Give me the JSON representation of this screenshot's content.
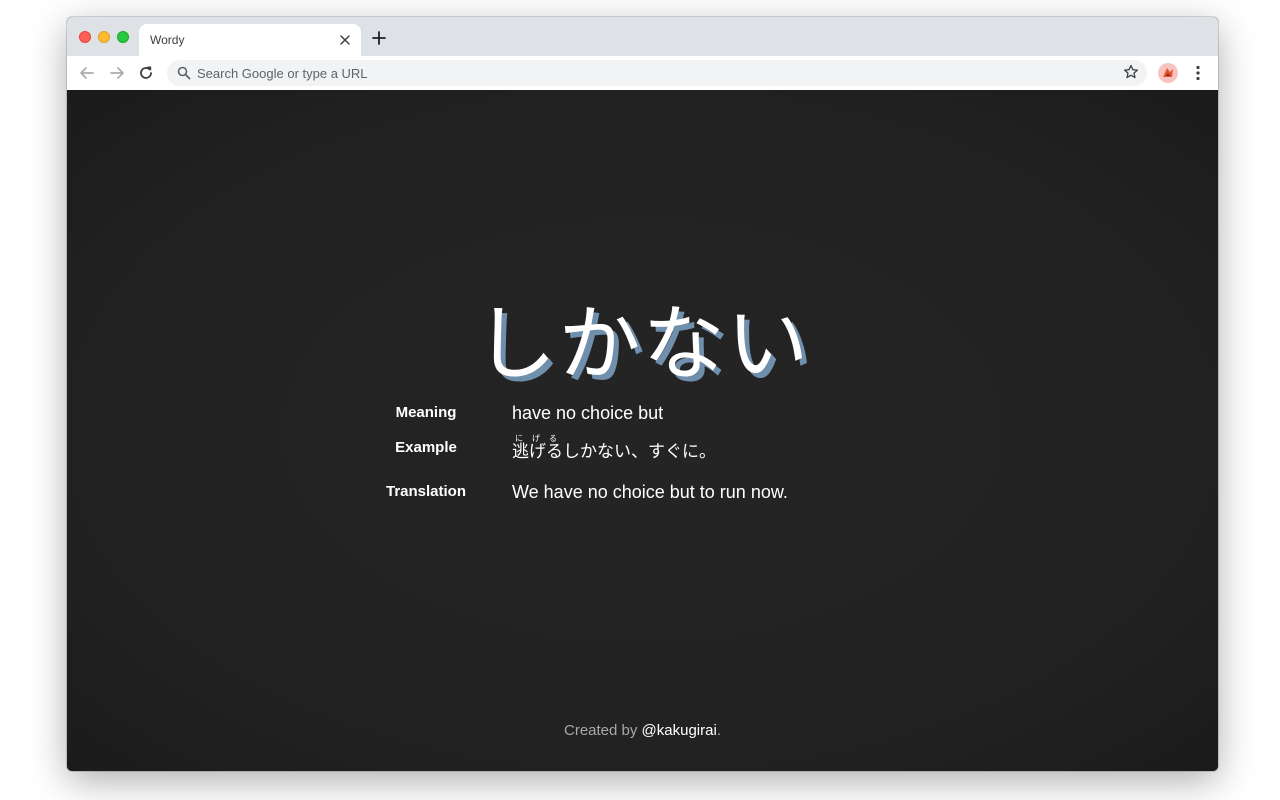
{
  "browser": {
    "tab_title": "Wordy",
    "omnibox_placeholder": "Search Google or type a URL"
  },
  "word": {
    "text": "しかない",
    "shadow_color": "#6f8fac"
  },
  "definition": {
    "meaning_label": "Meaning",
    "meaning_value": "have no choice but",
    "example_label": "Example",
    "example_kanji": "逃",
    "example_kanji_reading": "に",
    "example_okurigana_1": "げ",
    "example_okurigana_1_reading": "げ",
    "example_okurigana_2": "る",
    "example_okurigana_2_reading": "る",
    "example_rest": "しかない、すぐに。",
    "translation_label": "Translation",
    "translation_value": "We have no choice but to run now."
  },
  "footer": {
    "prefix": "Created by ",
    "handle": "@kakugirai",
    "suffix": "."
  },
  "colors": {
    "background": "#222222",
    "text": "#ffffff",
    "footer_text": "#a8a8a8"
  },
  "icons": {
    "back": "arrow-left-icon",
    "forward": "arrow-right-icon",
    "reload": "reload-icon",
    "search": "search-icon",
    "star": "star-icon",
    "extension": "extension-icon",
    "menu": "kebab-menu-icon",
    "close": "close-icon",
    "new_tab": "plus-icon"
  }
}
